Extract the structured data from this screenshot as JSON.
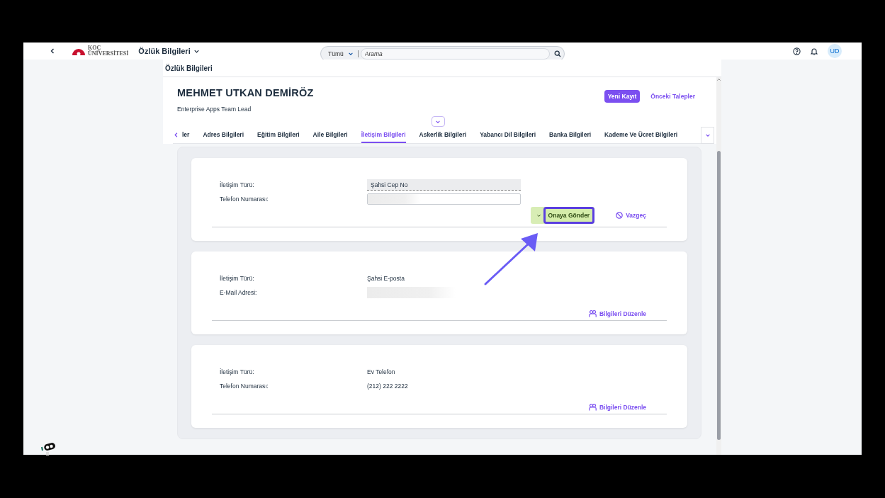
{
  "topbar": {
    "brand": {
      "line1": "KOÇ",
      "line2": "ÜNİVERSİTESİ"
    },
    "app_title": "Özlük Bilgileri",
    "search": {
      "scope": "Tümü",
      "placeholder": "Arama"
    },
    "avatar": "UD"
  },
  "page_title": "Özlük Bilgileri",
  "profile": {
    "name": "MEHMET UTKAN DEMİRÖZ",
    "role": "Enterprise Apps Team Lead",
    "actions": [
      {
        "label": "Yeni Kayıt",
        "kind": "primary"
      },
      {
        "label": "Önceki Talepler",
        "kind": "link"
      }
    ]
  },
  "tabs": [
    {
      "label": "ler",
      "selected": false
    },
    {
      "label": "Adres Bilgileri",
      "selected": false
    },
    {
      "label": "Eğitim Bilgileri",
      "selected": false
    },
    {
      "label": "Aile Bilgileri",
      "selected": false
    },
    {
      "label": "İletişim Bilgileri",
      "selected": true
    },
    {
      "label": "Askerlik Bilgileri",
      "selected": false
    },
    {
      "label": "Yabancı Dil Bilgileri",
      "selected": false
    },
    {
      "label": "Banka Bilgileri",
      "selected": false
    },
    {
      "label": "Kademe Ve Ücret Bilgileri",
      "selected": false
    }
  ],
  "records": [
    {
      "fields": [
        {
          "label": "İletişim Türü:",
          "kind": "select",
          "value": "Şahsi Cep No"
        },
        {
          "label": "Telefon Numarası:",
          "kind": "input_blurred"
        }
      ],
      "actions": [
        {
          "kind": "submit",
          "label": "Onaya Gönder",
          "highlighted": true
        },
        {
          "kind": "cancel",
          "label": "Vazgeç"
        }
      ]
    },
    {
      "fields": [
        {
          "label": "İletişim Türü:",
          "kind": "text",
          "value": "Şahsi E-posta"
        },
        {
          "label": "E-Mail Adresi:",
          "kind": "blurred"
        }
      ],
      "actions": [
        {
          "kind": "edit",
          "label": "Bilgileri Düzenle"
        }
      ]
    },
    {
      "fields": [
        {
          "label": "İletişim Türü:",
          "kind": "text",
          "value": "Ev Telefon"
        },
        {
          "label": "Telefon Numarası:",
          "kind": "text",
          "value": "(212) 222 2222"
        }
      ],
      "actions": [
        {
          "kind": "edit",
          "label": "Bilgileri Düzenle"
        }
      ]
    }
  ]
}
